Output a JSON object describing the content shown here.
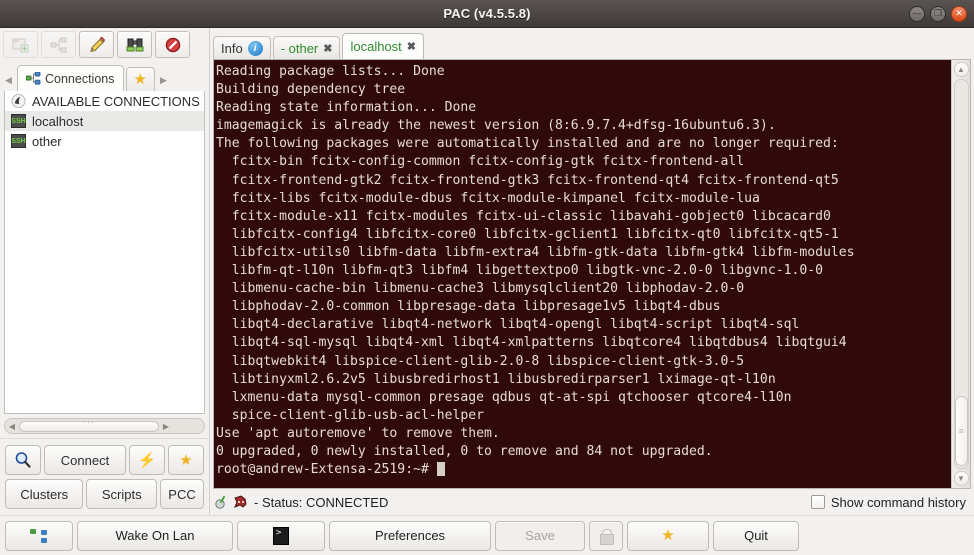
{
  "window": {
    "title": "PAC (v4.5.5.8)",
    "controls": [
      {
        "name": "minimize",
        "glyph": "—"
      },
      {
        "name": "maximize",
        "glyph": "❐"
      },
      {
        "name": "close",
        "glyph": "✕"
      }
    ]
  },
  "left_toolbar": {
    "buttons": [
      {
        "name": "add-group-icon",
        "glyph": "▣",
        "disabled": true
      },
      {
        "name": "cluster-icon",
        "glyph": "⑃",
        "disabled": true
      },
      {
        "name": "edit-pencil-icon",
        "glyph": "✏",
        "disabled": false
      },
      {
        "name": "find-binoculars-icon",
        "glyph": "🔭",
        "disabled": false
      },
      {
        "name": "stop-icon",
        "glyph": "🚫",
        "disabled": false
      }
    ]
  },
  "sidebar": {
    "tabs": [
      {
        "label": "Connections",
        "icon": "connections-icon",
        "active": true
      },
      {
        "label": "",
        "icon": "favourites-star-icon",
        "active": false
      }
    ],
    "scroll_left_arrow": "◀",
    "scroll_right_arrow": "▶",
    "tree": [
      {
        "label": "AVAILABLE CONNECTIONS",
        "icon": "group-icon",
        "selected": false
      },
      {
        "label": "localhost",
        "icon": "ssh-icon",
        "selected": true
      },
      {
        "label": "other",
        "icon": "ssh-icon",
        "selected": false
      }
    ],
    "buttons_row1": [
      {
        "label": "",
        "name": "search-button",
        "icon": "magnifier-icon"
      },
      {
        "label": "Connect",
        "name": "connect-button",
        "icon": ""
      },
      {
        "label": "",
        "name": "quick-connect-button",
        "icon": "lightning-icon"
      },
      {
        "label": "",
        "name": "favourite-button",
        "icon": "star-icon"
      }
    ],
    "buttons_row2": [
      {
        "label": "Clusters",
        "name": "clusters-button"
      },
      {
        "label": "Scripts",
        "name": "scripts-button"
      },
      {
        "label": "PCC",
        "name": "pcc-button"
      }
    ]
  },
  "tabs": [
    {
      "label": "Info",
      "icon": "info-icon",
      "closable": false,
      "active": false,
      "green": false
    },
    {
      "label": "- other",
      "icon": "",
      "closable": true,
      "active": false,
      "green": true
    },
    {
      "label": "localhost",
      "icon": "",
      "closable": true,
      "active": true,
      "green": true
    }
  ],
  "terminal": {
    "background": "#300a0a",
    "foreground": "#e6dcd2",
    "lines": [
      "Reading package lists... Done",
      "Building dependency tree",
      "Reading state information... Done",
      "imagemagick is already the newest version (8:6.9.7.4+dfsg-16ubuntu6.3).",
      "The following packages were automatically installed and are no longer required:",
      "  fcitx-bin fcitx-config-common fcitx-config-gtk fcitx-frontend-all",
      "  fcitx-frontend-gtk2 fcitx-frontend-gtk3 fcitx-frontend-qt4 fcitx-frontend-qt5",
      "  fcitx-libs fcitx-module-dbus fcitx-module-kimpanel fcitx-module-lua",
      "  fcitx-module-x11 fcitx-modules fcitx-ui-classic libavahi-gobject0 libcacard0",
      "  libfcitx-config4 libfcitx-core0 libfcitx-gclient1 libfcitx-qt0 libfcitx-qt5-1",
      "  libfcitx-utils0 libfm-data libfm-extra4 libfm-gtk-data libfm-gtk4 libfm-modules",
      "  libfm-qt-l10n libfm-qt3 libfm4 libgettextpo0 libgtk-vnc-2.0-0 libgvnc-1.0-0",
      "  libmenu-cache-bin libmenu-cache3 libmysqlclient20 libphodav-2.0-0",
      "  libphodav-2.0-common libpresage-data libpresage1v5 libqt4-dbus",
      "  libqt4-declarative libqt4-network libqt4-opengl libqt4-script libqt4-sql",
      "  libqt4-sql-mysql libqt4-xml libqt4-xmlpatterns libqtcore4 libqtdbus4 libqtgui4",
      "  libqtwebkit4 libspice-client-glib-2.0-8 libspice-client-gtk-3.0-5",
      "  libtinyxml2.6.2v5 libusbredirhost1 libusbredirparser1 lximage-qt-l10n",
      "  lxmenu-data mysql-common presage qdbus qt-at-spi qtchooser qtcore4-l10n",
      "  spice-client-glib-usb-acl-helper",
      "Use 'apt autoremove' to remove them.",
      "0 upgraded, 0 newly installed, 0 to remove and 84 not upgraded.",
      "root@andrew-Extensa-2519:~# "
    ],
    "scroll_up_arrow": "▲",
    "scroll_down_arrow": "▼"
  },
  "status": {
    "text": "- Status: CONNECTED",
    "checkbox_label": "Show command history",
    "checkbox_checked": false
  },
  "bottom_bar": {
    "buttons": [
      {
        "label": "",
        "name": "connections-toggle-button",
        "icon": "connections-icon",
        "disabled": false
      },
      {
        "label": "Wake On Lan",
        "name": "wake-on-lan-button",
        "icon": "",
        "disabled": false
      },
      {
        "label": "",
        "name": "local-shell-button",
        "icon": "terminal-icon",
        "disabled": false
      },
      {
        "label": "Preferences",
        "name": "preferences-button",
        "icon": "",
        "disabled": false
      },
      {
        "label": "Save",
        "name": "save-button",
        "icon": "",
        "disabled": true
      },
      {
        "label": "",
        "name": "lock-button",
        "icon": "lock-icon",
        "disabled": true
      },
      {
        "label": "",
        "name": "favourites-button",
        "icon": "star-icon",
        "disabled": false
      },
      {
        "label": "Quit",
        "name": "quit-button",
        "icon": "",
        "disabled": false
      }
    ]
  }
}
